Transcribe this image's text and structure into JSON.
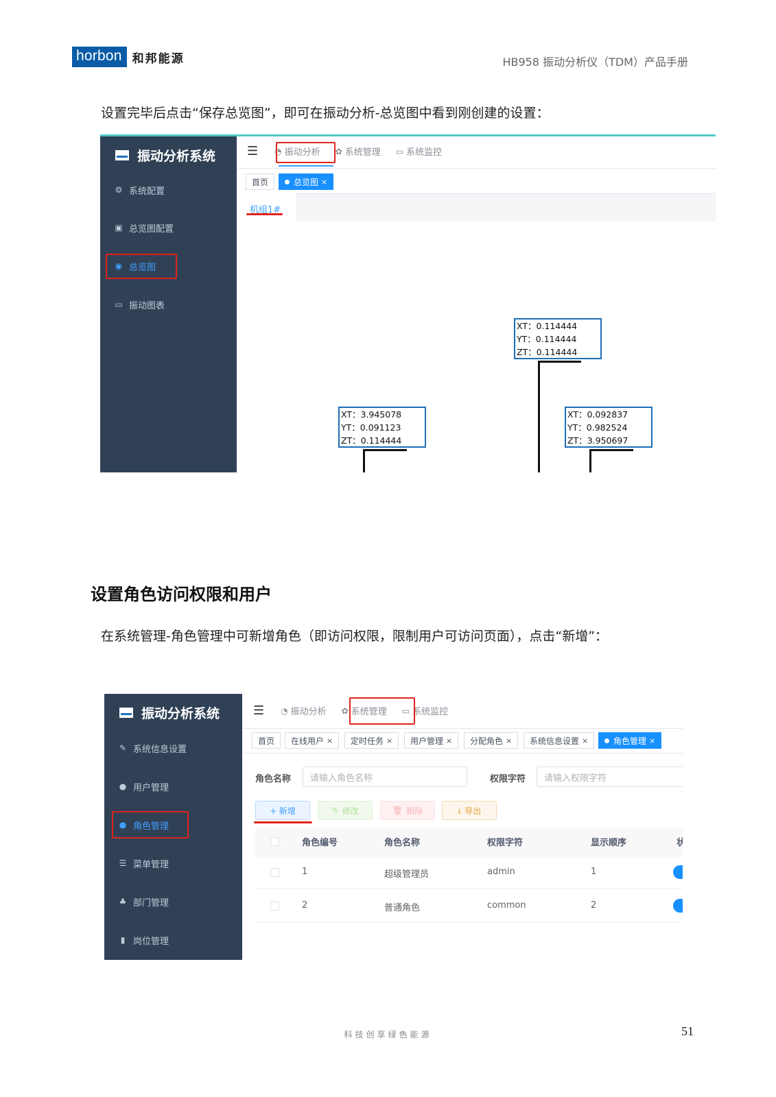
{
  "header": {
    "logo_text": "horbon",
    "logo_cn": "和邦能源",
    "doc_title": "HB958 振动分析仪（TDM）产品手册"
  },
  "para1": "设置完毕后点击“保存总览图”，即可在振动分析-总览图中看到刚创建的设置：",
  "shot1": {
    "app_title": "振动分析系统",
    "sidebar": [
      {
        "icon": "bug-icon",
        "glyph": "⚙",
        "label": "系统配置"
      },
      {
        "icon": "chart-config-icon",
        "glyph": "▣",
        "label": "总览图配置"
      },
      {
        "icon": "eye-icon",
        "glyph": "◉",
        "label": "总览图"
      },
      {
        "icon": "monitor-icon",
        "glyph": "▭",
        "label": "振动图表"
      }
    ],
    "topnav": [
      {
        "icon": "vibration-icon",
        "glyph": "◔",
        "label": "振动分析"
      },
      {
        "icon": "gear-icon",
        "glyph": "✿",
        "label": "系统管理"
      },
      {
        "icon": "monitor-icon",
        "glyph": "▭",
        "label": "系统监控"
      }
    ],
    "tags": [
      "首页",
      "总览图"
    ],
    "group_tab": "机组1#",
    "nodes": [
      {
        "xt": "XT：0.114444",
        "yt": "YT：0.114444",
        "zt": "ZT：0.114444"
      },
      {
        "xt": "XT：3.945078",
        "yt": "YT：0.091123",
        "zt": "ZT：0.114444"
      },
      {
        "xt": "XT：0.092837",
        "yt": "YT：0.982524",
        "zt": "ZT：3.950697"
      }
    ]
  },
  "heading2": "设置角色访问权限和用户",
  "para2": "在系统管理-角色管理中可新增角色（即访问权限，限制用户可访问页面），点击“新增”：",
  "shot2": {
    "app_title": "振动分析系统",
    "sidebar": [
      {
        "icon": "edit-icon",
        "glyph": "✎",
        "label": "系统信息设置"
      },
      {
        "icon": "user-icon",
        "glyph": "●",
        "label": "用户管理"
      },
      {
        "icon": "role-icon",
        "glyph": "●",
        "label": "角色管理"
      },
      {
        "icon": "menu-tree-icon",
        "glyph": "☰",
        "label": "菜单管理"
      },
      {
        "icon": "org-icon",
        "glyph": "♣",
        "label": "部门管理"
      },
      {
        "icon": "post-icon",
        "glyph": "▮",
        "label": "岗位管理"
      }
    ],
    "topnav": [
      {
        "icon": "vibration-icon",
        "glyph": "◔",
        "label": "振动分析"
      },
      {
        "icon": "gear-icon",
        "glyph": "✿",
        "label": "系统管理"
      },
      {
        "icon": "monitor-icon",
        "glyph": "▭",
        "label": "系统监控"
      }
    ],
    "tags": [
      "首页",
      "在线用户",
      "定时任务",
      "用户管理",
      "分配角色",
      "系统信息设置",
      "角色管理"
    ],
    "search": {
      "role_name_label": "角色名称",
      "role_name_placeholder": "请输入角色名称",
      "perm_label": "权限字符",
      "perm_placeholder": "请输入权限字符"
    },
    "buttons": {
      "add": "+ 新增",
      "edit": "修改",
      "delete": "删除",
      "export": "导出"
    },
    "table": {
      "headers": [
        "角色编号",
        "角色名称",
        "权限字符",
        "显示顺序",
        "状"
      ],
      "rows": [
        [
          "1",
          "超级管理员",
          "admin",
          "1"
        ],
        [
          "2",
          "普通角色",
          "common",
          "2"
        ]
      ]
    }
  },
  "footer": {
    "motto": "科技创享绿色能源",
    "page": "51"
  }
}
